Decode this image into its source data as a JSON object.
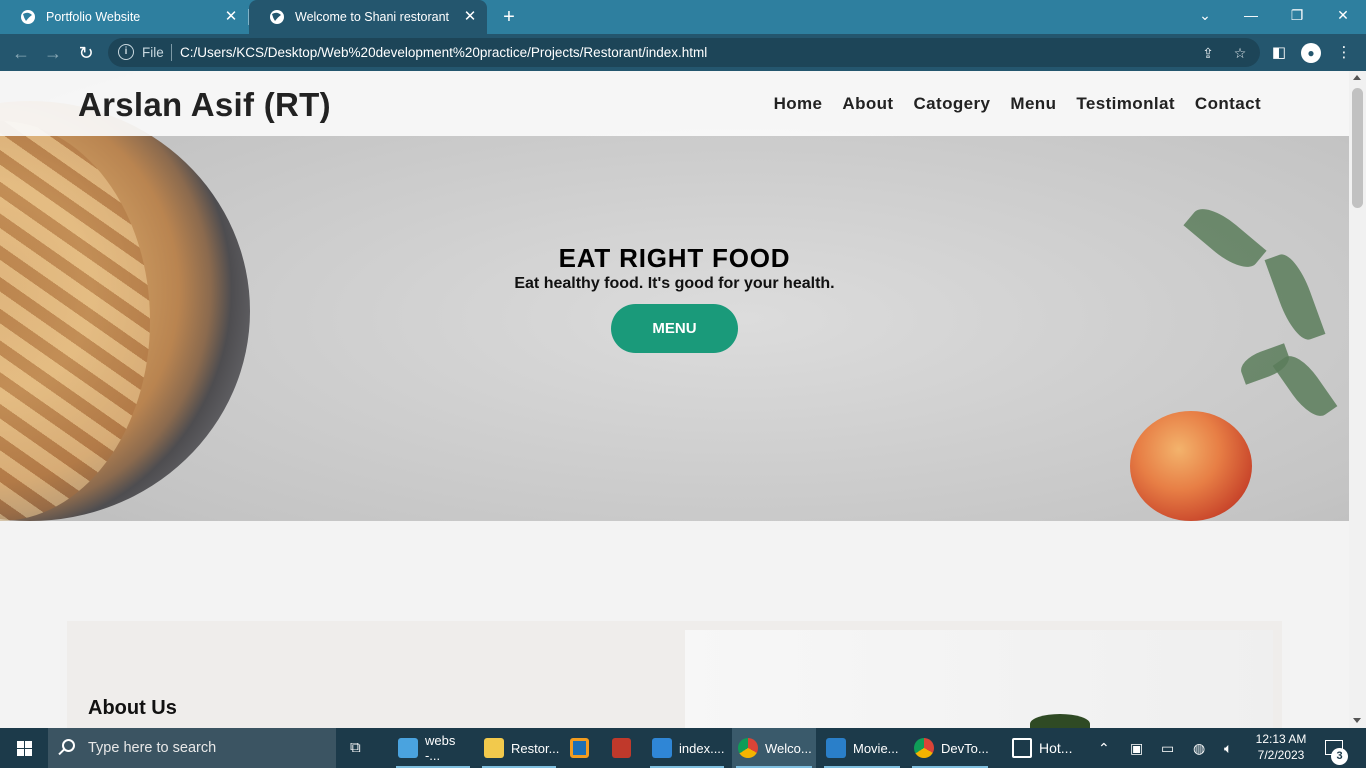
{
  "browser": {
    "tabs": [
      {
        "title": "Portfolio Website",
        "active": false
      },
      {
        "title": "Welcome to Shani restorant",
        "active": true
      }
    ],
    "file_label": "File",
    "url": "C:/Users/KCS/Desktop/Web%20development%20practice/Projects/Restorant/index.html"
  },
  "site": {
    "logo": "Arslan Asif (RT)",
    "nav": [
      "Home",
      "About",
      "Catogery",
      "Menu",
      "Testimonlat",
      "Contact"
    ],
    "hero": {
      "title": "EAT RIGHT FOOD",
      "subtitle": "Eat healthy food. It's good for your health.",
      "button": "MENU"
    },
    "about_title": "About Us"
  },
  "taskbar": {
    "search_placeholder": "Type here to search",
    "apps": [
      {
        "label": "webs -...",
        "icon": "cube-icon"
      },
      {
        "label": "Restor...",
        "icon": "folder-icon"
      },
      {
        "label": "",
        "icon": "vm-icon"
      },
      {
        "label": "",
        "icon": "archive-icon"
      },
      {
        "label": "index....",
        "icon": "vscode-icon"
      },
      {
        "label": "Welco...",
        "icon": "chrome-icon"
      },
      {
        "label": "Movie...",
        "icon": "movie-icon"
      },
      {
        "label": "DevTo...",
        "icon": "chrome-icon"
      },
      {
        "label": "Hot...",
        "icon": "news-icon"
      }
    ],
    "time": "12:13 AM",
    "date": "7/2/2023",
    "notifications": "3"
  },
  "colors": {
    "tab_bar": "#2e7f9f",
    "toolbar": "#24566e",
    "hero_button": "#1a9a7a"
  }
}
